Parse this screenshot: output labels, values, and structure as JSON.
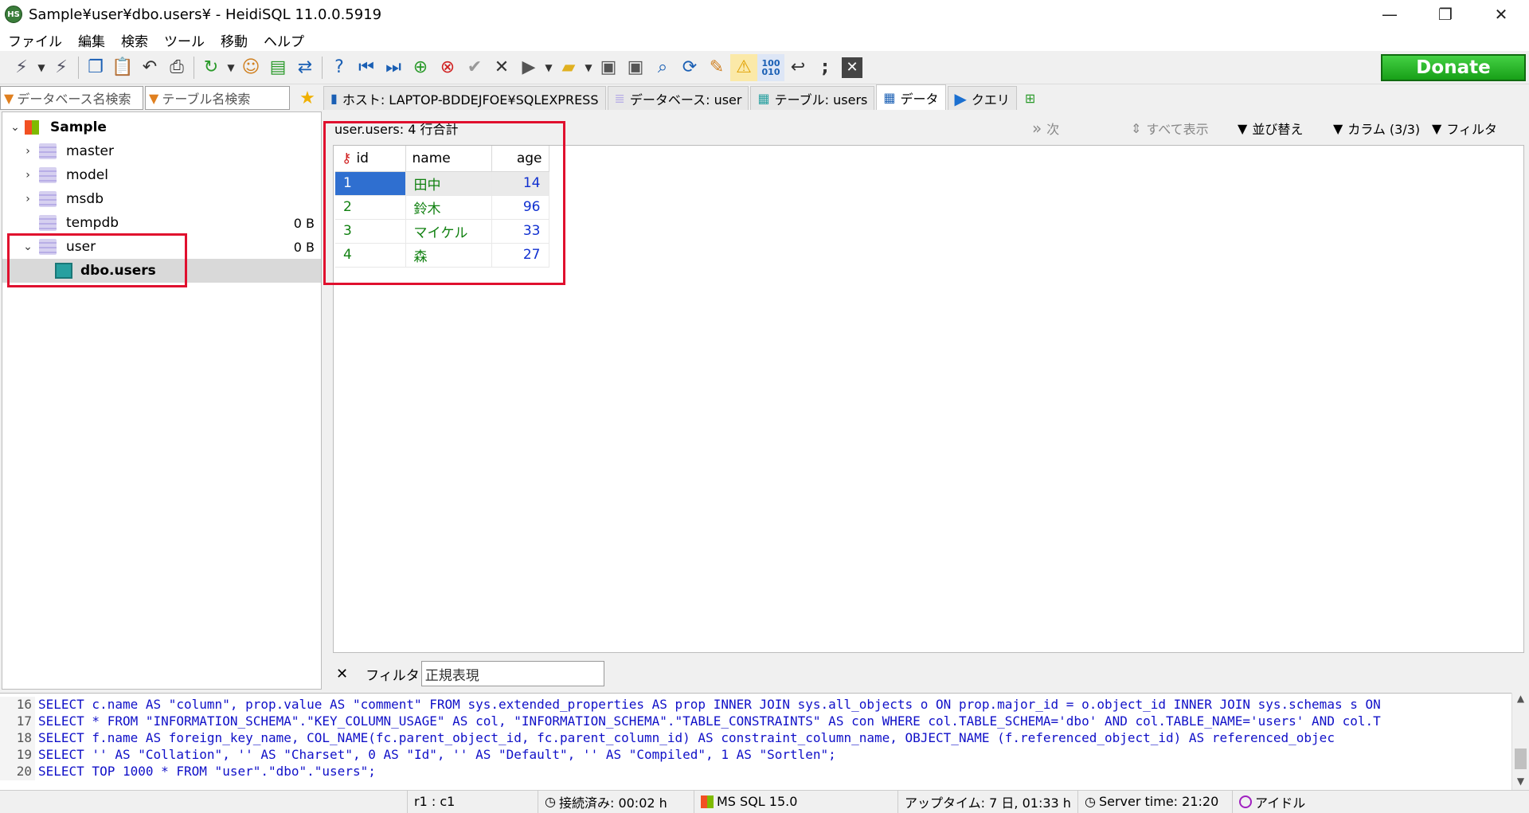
{
  "window": {
    "title": "Sample¥user¥dbo.users¥ - HeidiSQL 11.0.0.5919",
    "app_icon_text": "HS",
    "minimize": "—",
    "restore": "❐",
    "close": "✕"
  },
  "menu": [
    "ファイル",
    "編集",
    "検索",
    "ツール",
    "移動",
    "ヘルプ"
  ],
  "donate_label": "Donate",
  "filters": {
    "db_search_placeholder": "データベース名検索",
    "table_search_placeholder": "テーブル名検索"
  },
  "tabs": [
    {
      "label": "ホスト: LAPTOP-BDDEJFOE¥SQLEXPRESS",
      "icon": "server-icon"
    },
    {
      "label": "データベース: user",
      "icon": "database-icon"
    },
    {
      "label": "テーブル: users",
      "icon": "table-icon"
    },
    {
      "label": "データ",
      "icon": "grid-icon"
    },
    {
      "label": "クエリ",
      "icon": "play-icon"
    }
  ],
  "tree": {
    "root": "Sample",
    "dbs": [
      {
        "name": "master",
        "size": ""
      },
      {
        "name": "model",
        "size": ""
      },
      {
        "name": "msdb",
        "size": ""
      },
      {
        "name": "tempdb",
        "size": "0 B"
      },
      {
        "name": "user",
        "size": "0 B"
      }
    ],
    "table": "dbo.users"
  },
  "data_tab": {
    "header": "user.users: 4 行合計",
    "next_label": "次",
    "show_all_label": "すべて表示",
    "sort_label": "並び替え",
    "columns_label": "カラム (3/3)",
    "filter_label": "フィルタ"
  },
  "grid": {
    "columns": [
      "id",
      "name",
      "age"
    ],
    "rows": [
      {
        "id": "1",
        "name": "田中",
        "age": "14"
      },
      {
        "id": "2",
        "name": "鈴木",
        "age": "96"
      },
      {
        "id": "3",
        "name": "マイケル",
        "age": "33"
      },
      {
        "id": "4",
        "name": "森",
        "age": "27"
      }
    ]
  },
  "filterbar": {
    "close": "✕",
    "label": "フィルタ",
    "placeholder": "正規表現"
  },
  "sql_log": [
    {
      "n": "16",
      "text": "SELECT c.name AS \"column\", prop.value AS \"comment\" FROM sys.extended_properties AS prop INNER JOIN sys.all_objects o ON prop.major_id = o.object_id INNER JOIN sys.schemas s ON"
    },
    {
      "n": "17",
      "text": "SELECT * FROM \"INFORMATION_SCHEMA\".\"KEY_COLUMN_USAGE\" AS col, \"INFORMATION_SCHEMA\".\"TABLE_CONSTRAINTS\" AS con WHERE col.TABLE_SCHEMA='dbo' AND col.TABLE_NAME='users' AND col.T"
    },
    {
      "n": "18",
      "text": "SELECT   f.name AS foreign_key_name,   COL_NAME(fc.parent_object_id, fc.parent_column_id) AS constraint_column_name,   OBJECT_NAME (f.referenced_object_id) AS referenced_objec"
    },
    {
      "n": "19",
      "text": "SELECT '' AS \"Collation\", '' AS \"Charset\", 0 AS \"Id\", '' AS \"Default\", '' AS \"Compiled\", 1 AS \"Sortlen\";"
    },
    {
      "n": "20",
      "text": "SELECT TOP 1000 * FROM \"user\".\"dbo\".\"users\";"
    }
  ],
  "status": {
    "cursor": "r1 : c1",
    "connected": "接続済み: 00:02 h",
    "server": "MS SQL 15.0",
    "uptime": "アップタイム: 7 日, 01:33 h",
    "server_time": "Server time: 21:20",
    "state": "アイドル"
  },
  "colors": {
    "donate": "#18a018",
    "highlight_box": "#e0102e",
    "selected_cell": "#2f6fd0",
    "text_green": "#108010",
    "number_blue": "#1030d0"
  }
}
